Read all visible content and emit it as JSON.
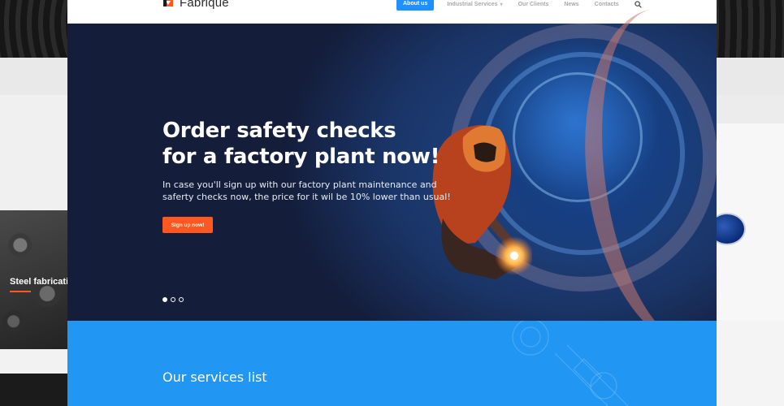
{
  "brand": {
    "name": "Fabrique"
  },
  "nav": {
    "items": [
      {
        "label": "About us",
        "active": true
      },
      {
        "label": "Industrial Services",
        "has_dropdown": true
      },
      {
        "label": "Our Clients"
      },
      {
        "label": "News"
      },
      {
        "label": "Contacts"
      }
    ],
    "search_icon": "search-icon"
  },
  "hero": {
    "title_line1": "Order safety checks",
    "title_line2": "for a factory plant now!",
    "text_line1": "In case you'll sign up with our factory plant maintenance and",
    "text_line2": "saferty checks now, the price for it wil be 10% lower than usual!",
    "button_label": "Sign up now!",
    "slides_total": 3,
    "slide_active": 1
  },
  "services": {
    "title": "Our services list"
  },
  "background_page": {
    "tile_label": "Steel fabrication"
  },
  "colors": {
    "accent_blue": "#1e90ff",
    "accent_orange": "#ff5722",
    "services_blue": "#2196f3"
  }
}
